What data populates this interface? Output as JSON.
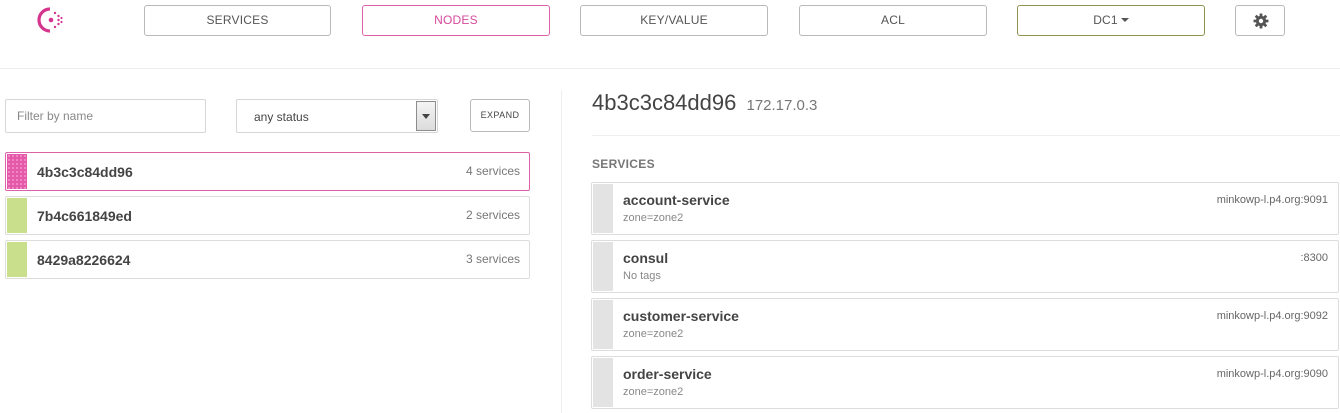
{
  "nav": {
    "services_label": "SERVICES",
    "nodes_label": "NODES",
    "kv_label": "KEY/VALUE",
    "acl_label": "ACL",
    "dc_label": "DC1",
    "settings_icon": "gear-icon",
    "logo_icon": "consul-logo"
  },
  "filters": {
    "name_placeholder": "Filter by name",
    "status_value": "any status",
    "expand_label": "EXPAND"
  },
  "nodes": [
    {
      "name": "4b3c3c84dd96",
      "services": "4 services",
      "active": true
    },
    {
      "name": "7b4c661849ed",
      "services": "2 services",
      "active": false
    },
    {
      "name": "8429a8226624",
      "services": "3 services",
      "active": false
    }
  ],
  "detail": {
    "node_name": "4b3c3c84dd96",
    "node_ip": "172.17.0.3",
    "services_heading": "SERVICES",
    "services": [
      {
        "name": "account-service",
        "tags": "zone=zone2",
        "address": "minkowp-l.p4.org:9091"
      },
      {
        "name": "consul",
        "tags": "No tags",
        "address": ":8300"
      },
      {
        "name": "customer-service",
        "tags": "zone=zone2",
        "address": "minkowp-l.p4.org:9092"
      },
      {
        "name": "order-service",
        "tags": "zone=zone2",
        "address": "minkowp-l.p4.org:9090"
      }
    ]
  },
  "colors": {
    "accent": "#de60a8",
    "dc_border": "#8f934e",
    "healthy": "#c9df8b",
    "service_bar": "#e3e3e3"
  }
}
